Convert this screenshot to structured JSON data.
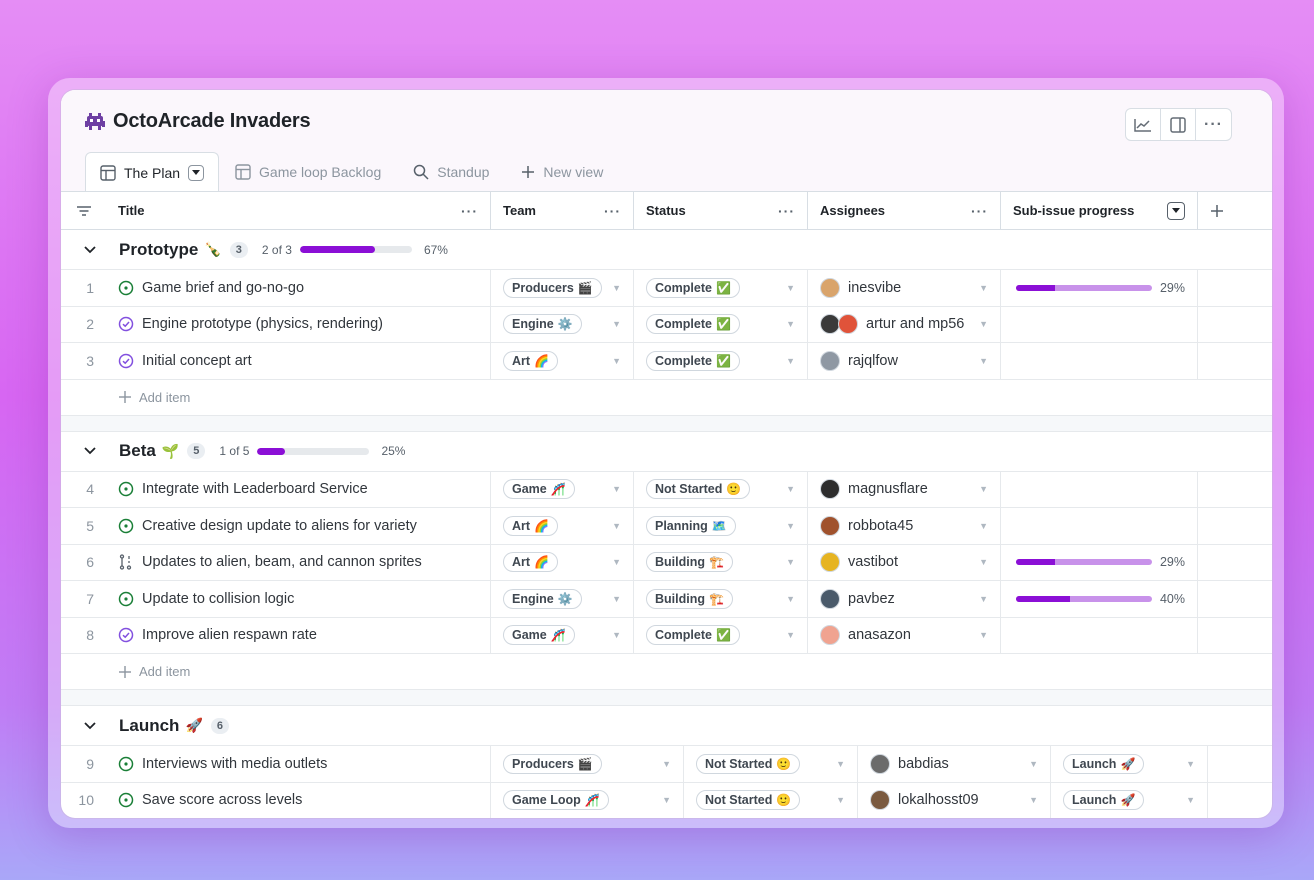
{
  "app": {
    "title": "OctoArcade Invaders",
    "icon": "alien-invader-icon"
  },
  "tabs": [
    {
      "label": "The Plan",
      "icon": "table-icon",
      "active": true
    },
    {
      "label": "Game loop Backlog",
      "icon": "table-icon",
      "active": false
    },
    {
      "label": "Standup",
      "icon": "search-icon",
      "active": false
    },
    {
      "label": "New view",
      "icon": "plus-icon",
      "active": false
    }
  ],
  "columns": {
    "title": "Title",
    "team": "Team",
    "status": "Status",
    "assignees": "Assignees",
    "progress": "Sub-issue progress"
  },
  "add_item_label": "Add item",
  "groups": [
    {
      "name": "Prototype",
      "emoji": "🍾",
      "count": "3",
      "progress_text": "2 of 3",
      "progress": 0.67,
      "progress_pct": "67%",
      "rows": [
        {
          "num": "1",
          "title": "Game brief and go-no-go",
          "state": "open",
          "team": "Producers",
          "team_emoji": "🎬",
          "status": "Complete",
          "status_emoji": "✅",
          "assignee": "inesvibe",
          "avatar_color": "#d9a46b",
          "progress": 0.29,
          "progress_pct": "29%"
        },
        {
          "num": "2",
          "title": "Engine prototype (physics, rendering)",
          "state": "closed",
          "team": "Engine",
          "team_emoji": "⚙️",
          "status": "Complete",
          "status_emoji": "✅",
          "assignee": "artur and mp56",
          "avatar_color": "#3a3a3a",
          "avatar_color2": "#e0533a",
          "progress": null,
          "progress_pct": ""
        },
        {
          "num": "3",
          "title": "Initial concept art",
          "state": "closed",
          "team": "Art",
          "team_emoji": "🌈",
          "status": "Complete",
          "status_emoji": "✅",
          "assignee": "rajqlfow",
          "avatar_color": "#8f98a3",
          "progress": null,
          "progress_pct": ""
        }
      ]
    },
    {
      "name": "Beta",
      "emoji": "🌱",
      "count": "5",
      "progress_text": "1 of 5",
      "progress": 0.25,
      "progress_pct": "25%",
      "rows": [
        {
          "num": "4",
          "title": "Integrate with Leaderboard Service",
          "state": "open",
          "team": "Game",
          "team_emoji": "🎢",
          "status": "Not Started",
          "status_emoji": "🙂",
          "assignee": "magnusflare",
          "avatar_color": "#2d2d2d",
          "progress": null,
          "progress_pct": ""
        },
        {
          "num": "5",
          "title": "Creative design update to aliens for variety",
          "state": "open",
          "team": "Art",
          "team_emoji": "🌈",
          "status": "Planning",
          "status_emoji": "🗺️",
          "assignee": "robbota45",
          "avatar_color": "#a0522d",
          "progress": null,
          "progress_pct": ""
        },
        {
          "num": "6",
          "title": "Updates to alien, beam, and cannon sprites",
          "state": "draft",
          "team": "Art",
          "team_emoji": "🌈",
          "status": "Building",
          "status_emoji": "🏗️",
          "assignee": "vastibot",
          "avatar_color": "#e6b422",
          "progress": 0.29,
          "progress_pct": "29%"
        },
        {
          "num": "7",
          "title": "Update to collision logic",
          "state": "open",
          "team": "Engine",
          "team_emoji": "⚙️",
          "status": "Building",
          "status_emoji": "🏗️",
          "assignee": "pavbez",
          "avatar_color": "#4a5a6a",
          "progress": 0.4,
          "progress_pct": "40%"
        },
        {
          "num": "8",
          "title": "Improve alien respawn rate",
          "state": "closed",
          "team": "Game",
          "team_emoji": "🎢",
          "status": "Complete",
          "status_emoji": "✅",
          "assignee": "anasazon",
          "avatar_color": "#f0a390",
          "progress": null,
          "progress_pct": ""
        }
      ]
    },
    {
      "name": "Launch",
      "emoji": "🚀",
      "count": "6",
      "rows": [
        {
          "num": "9",
          "title": "Interviews with media outlets",
          "state": "open",
          "team": "Producers",
          "team_emoji": "🎬",
          "status": "Not Started",
          "status_emoji": "🙂",
          "assignee": "babdias",
          "avatar_color": "#6b6b6b",
          "milestone": "Launch",
          "milestone_emoji": "🚀"
        },
        {
          "num": "10",
          "title": "Save score across levels",
          "state": "open",
          "team": "Game Loop",
          "team_emoji": "🎢",
          "status": "Not Started",
          "status_emoji": "🙂",
          "assignee": "lokalhosst09",
          "avatar_color": "#7a5a40",
          "milestone": "Launch",
          "milestone_emoji": "🚀"
        }
      ]
    }
  ],
  "colors": {
    "accent_purple": "#8b0fd6",
    "open_green": "#1a7f37",
    "closed_purple": "#8250df"
  }
}
